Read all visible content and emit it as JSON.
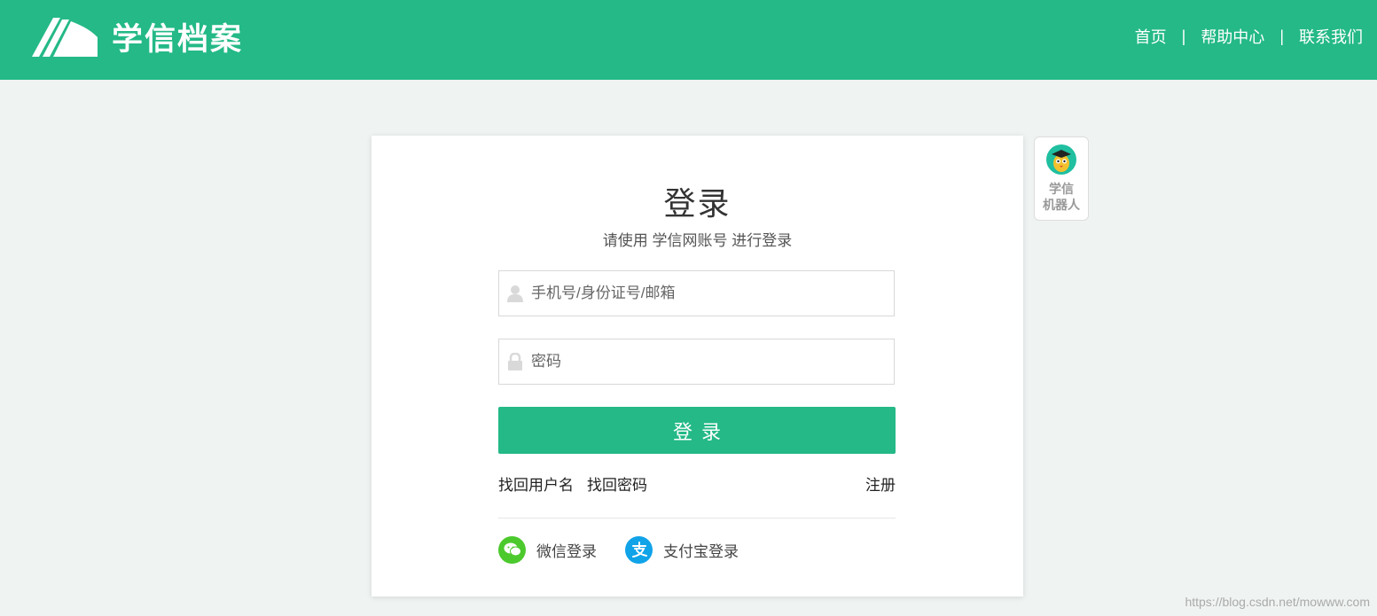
{
  "header": {
    "logo_text": "学信档案",
    "nav": [
      {
        "label": "首页"
      },
      {
        "label": "帮助中心"
      },
      {
        "label": "联系我们"
      }
    ],
    "separator": "|",
    "bg_color": "#24b987"
  },
  "login": {
    "title": "登录",
    "subtitle": "请使用 学信网账号 进行登录",
    "username_placeholder": "手机号/身份证号/邮箱",
    "password_placeholder": "密码",
    "submit_label": "登录",
    "find_username": "找回用户名",
    "find_password": "找回密码",
    "register": "注册",
    "wechat_login": "微信登录",
    "alipay_login": "支付宝登录"
  },
  "robot": {
    "label_line1": "学信",
    "label_line2": "机器人"
  },
  "watermark": "https://blog.csdn.net/mowww.com",
  "icons": {
    "user": "user-icon",
    "lock": "lock-icon",
    "wechat": "wechat-icon",
    "alipay": "alipay-icon",
    "logo": "book-logo-icon",
    "robot": "robot-avatar-icon"
  }
}
